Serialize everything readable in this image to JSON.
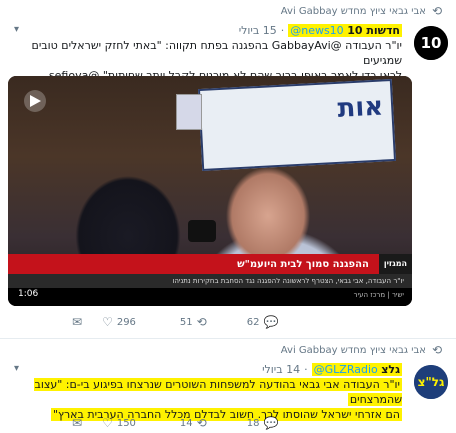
{
  "tweets": [
    {
      "retweeted_by": "אבי גבאי ציוץ מחדש Avi Gabbay",
      "name": "חדשות 10",
      "handle": "@news10",
      "date": "15 ביולי",
      "avatar_text": "10",
      "text_line1": "יו\"ר העבודה @GabbayAvi בהפגנה בפתח תקווה: \"באתי לחזק ישראלים טובים שמגיעים",
      "text_line2": "לכאן כדי לאמר באופן ברור שהם לא מוכנים לקבל יותר שחיתות\" @sefiova",
      "media": {
        "sign_text": "אות",
        "lower_tag": "המגזין",
        "headline": "ההפגנה סמוך לבית היועמ\"ש",
        "subline": "יו\"ר העבודה, אבי גבאי, הצטרף לראשונה להפגנה נגד הסחבת בחקירות נתניהו",
        "ticker": "ישיר | מרכז העיר",
        "timecode": "1:06"
      },
      "actions": {
        "reply": "",
        "retweets": "51",
        "likes": "296",
        "mail": "",
        "replies": "62"
      }
    },
    {
      "retweeted_by": "אבי גבאי ציוץ מחדש Avi Gabbay",
      "name": "גלצ",
      "handle": "@GLZRadio",
      "date": "14 ביולי",
      "avatar_text": "גל\"צ",
      "text_line1": "יו\"ר העבודה אבי גבאי בהודעה למשפחות השוטרים שנרצחו בפיגוע בי-ם: \"עצוב שהמרצחים",
      "text_line2": "הם אזרחי ישראל שהוסתו לכך. חשוב לבדלם מכלל החברה הערבית בארץ\"",
      "actions": {
        "replies": "18",
        "retweets": "14",
        "likes": "150",
        "mail": ""
      }
    }
  ],
  "colors": {
    "highlight": "#fff200",
    "link": "#1da1f2",
    "muted": "#657786"
  }
}
